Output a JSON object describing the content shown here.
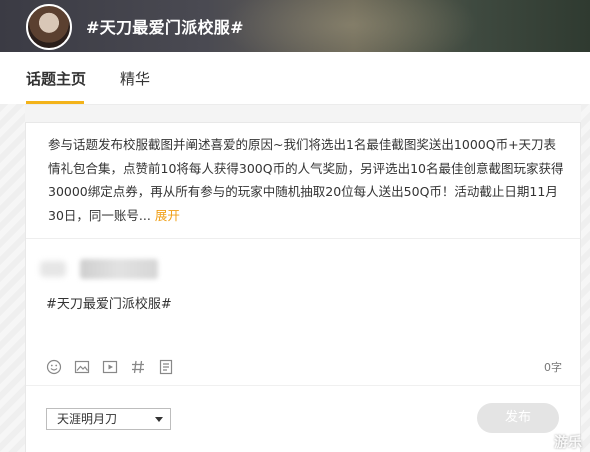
{
  "header": {
    "title": "#天刀最爱门派校服#"
  },
  "tabs": [
    {
      "label": "话题主页",
      "active": true
    },
    {
      "label": "精华",
      "active": false
    }
  ],
  "topic": {
    "description": "参与话题发布校服截图并阐述喜爱的原因~我们将选出1名最佳截图奖送出1000Q币+天刀表情礼包合集，点赞前10将每人获得300Q币的人气奖励，另评选出10名最佳创意截图玩家获得30000绑定点券，再从所有参与的玩家中随机抽取20位每人送出50Q币！活动截止日期11月30日，同一账号...",
    "expand_label": "展开"
  },
  "editor": {
    "text": "#天刀最爱门派校服#",
    "char_count": "0字",
    "tools": [
      "emoji-icon",
      "image-icon",
      "video-icon",
      "hashtag-icon",
      "document-icon"
    ]
  },
  "footer": {
    "selected_option": "天涯明月刀",
    "publish_label": "发布",
    "watermark": "游乐"
  },
  "colors": {
    "accent": "#f3b31a",
    "expand": "#f0a018",
    "publish_disabled": "#e4e4e4"
  }
}
